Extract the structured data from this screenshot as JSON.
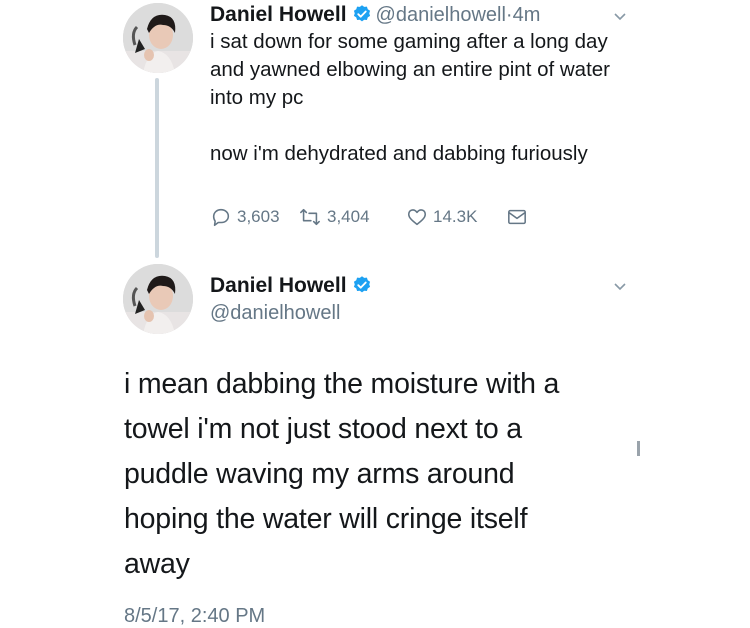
{
  "colors": {
    "verified_blue": "#1da1f2",
    "text_primary": "#14171a",
    "text_secondary": "#657786",
    "thread_line": "#ccd6dd"
  },
  "tweet1": {
    "author_name": "Daniel Howell",
    "verified_icon": "verified-badge-icon",
    "handle": "@danielhowell",
    "separator": "·",
    "time": "4m",
    "body_paragraphs": [
      "i sat down for some gaming after a long day and yawned elbowing an entire pint of water into my pc",
      "now i'm dehydrated and dabbing furiously"
    ],
    "actions": {
      "reply_icon": "reply-bubble-icon",
      "reply_count": "3,603",
      "retweet_icon": "retweet-icon",
      "retweet_count": "3,404",
      "like_icon": "heart-icon",
      "like_count": "14.3K",
      "dm_icon": "envelope-icon"
    },
    "menu_icon": "chevron-down-icon"
  },
  "tweet2": {
    "author_name": "Daniel Howell",
    "verified_icon": "verified-badge-icon",
    "handle": "@danielhowell",
    "body": "i mean dabbing the moisture with a towel i'm not just stood next to a puddle waving my arms around hoping the water will cringe itself away",
    "timestamp": "8/5/17, 2:40 PM",
    "menu_icon": "chevron-down-icon"
  }
}
